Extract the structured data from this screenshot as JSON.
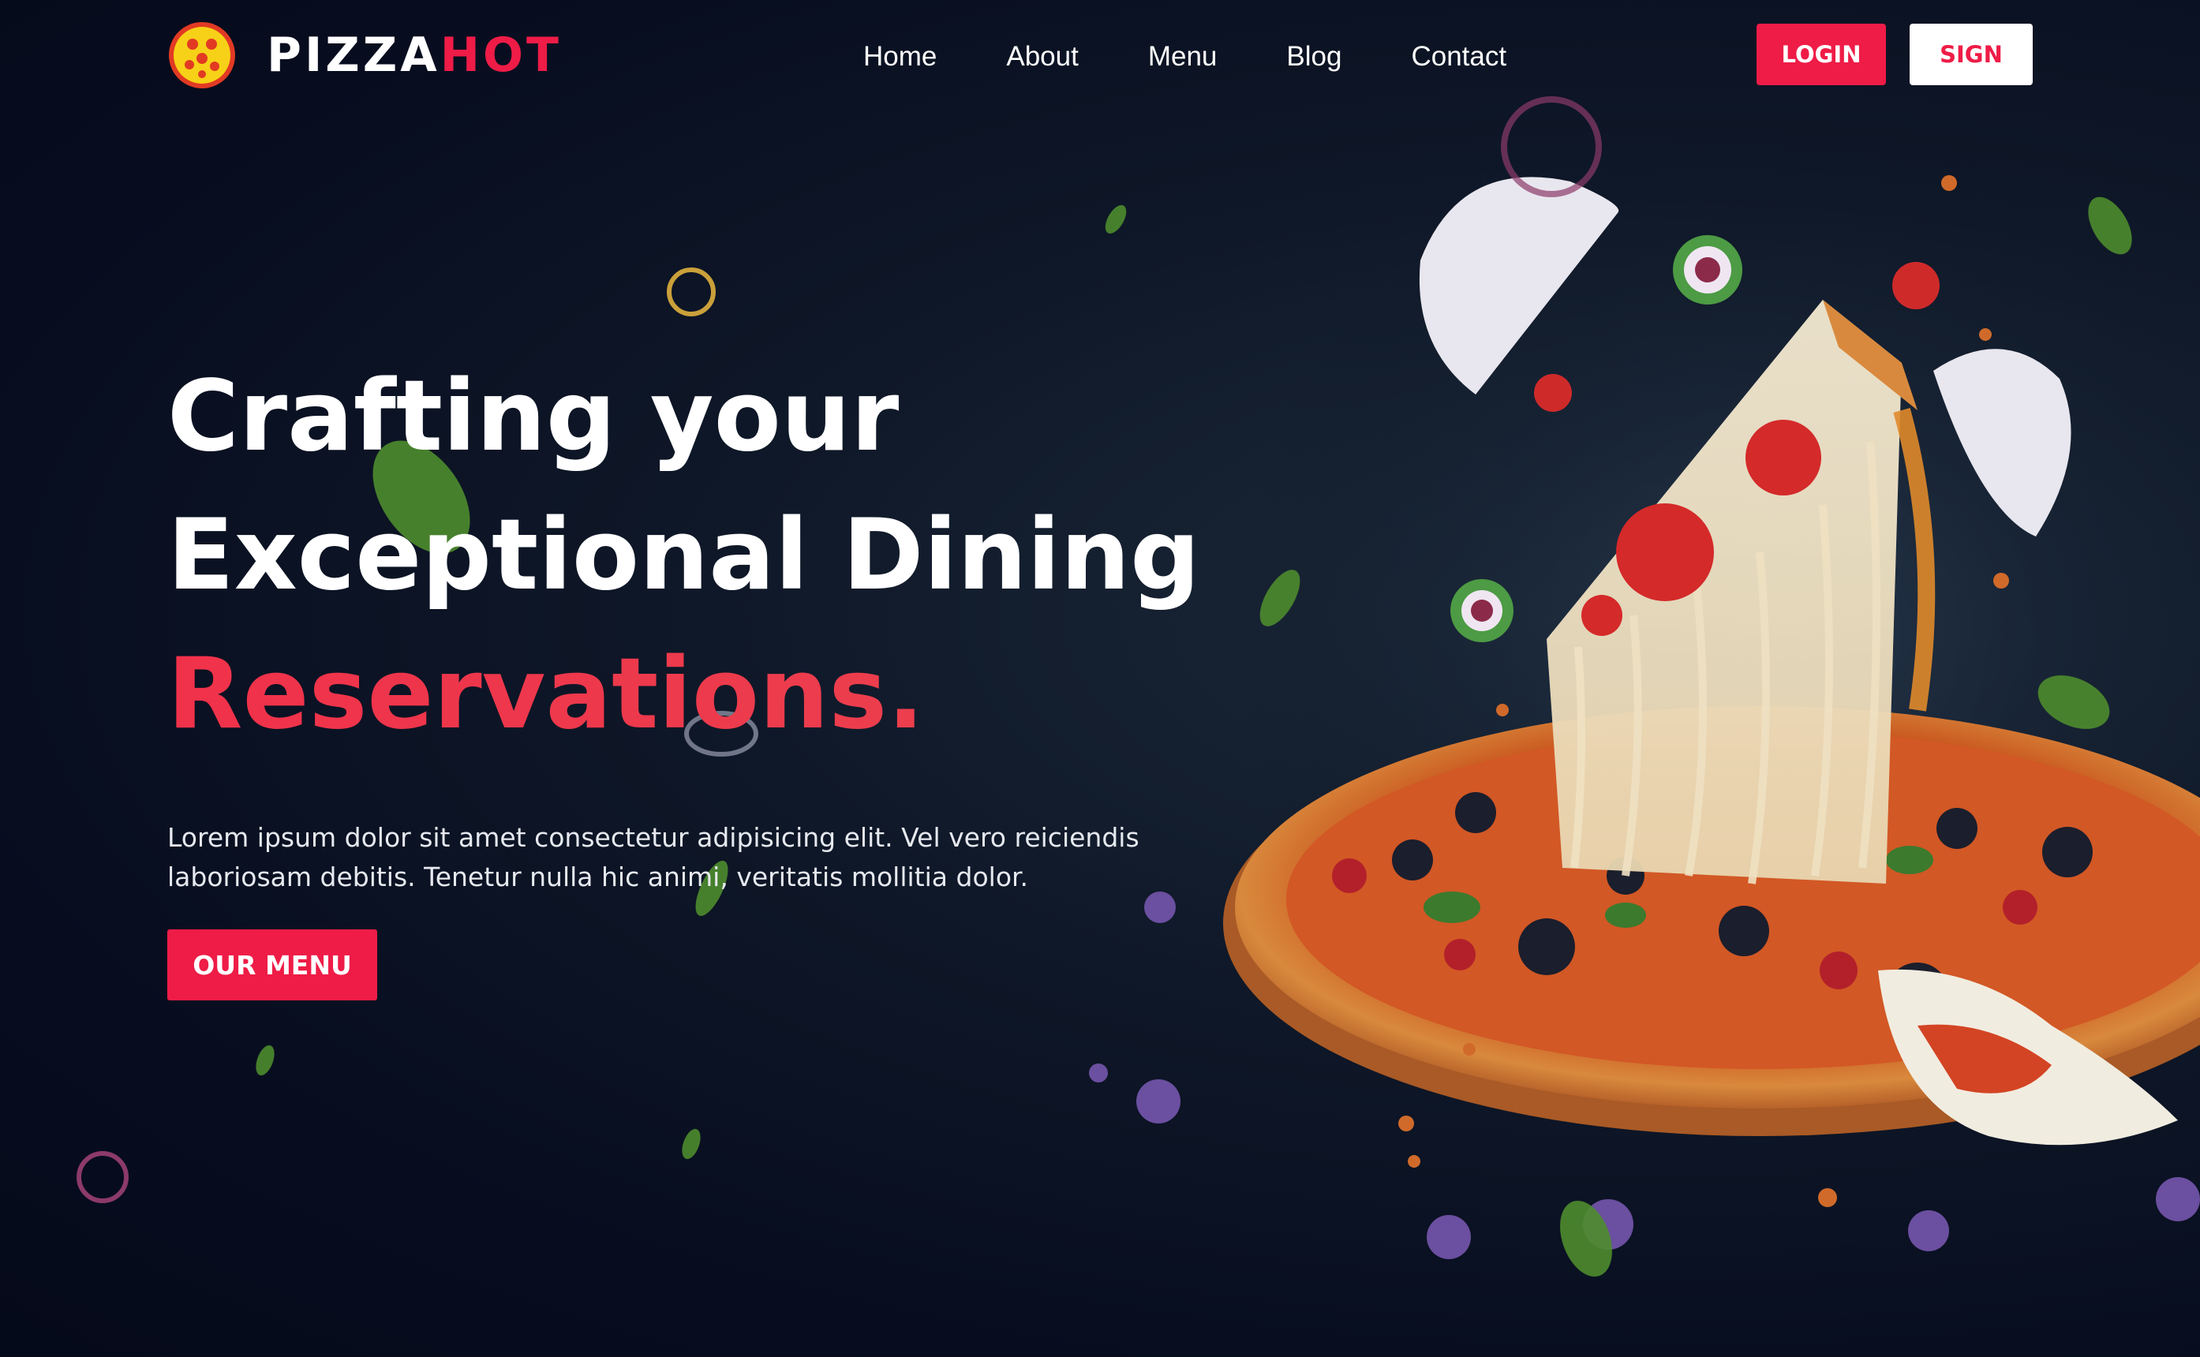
{
  "brand": {
    "name_part1": "PIZZA",
    "name_part2": "HOT"
  },
  "nav": {
    "items": [
      "Home",
      "About",
      "Menu",
      "Blog",
      "Contact"
    ]
  },
  "auth": {
    "login_label": "LOGIN",
    "sign_label": "SIGN"
  },
  "hero": {
    "line1": "Crafting your",
    "line2": "Exceptional Dining",
    "line3": "Reservations.",
    "description": "Lorem ipsum dolor sit amet consectetur adipisicing elit. Vel vero reiciendis laboriosam debitis. Tenetur nulla hic animi, veritatis mollitia dolor.",
    "cta_label": "OUR MENU"
  },
  "colors": {
    "accent": "#ee1c47",
    "background": "#070d1f",
    "text": "#ffffff"
  },
  "icons": {
    "logo": "pizza-logo-icon"
  }
}
